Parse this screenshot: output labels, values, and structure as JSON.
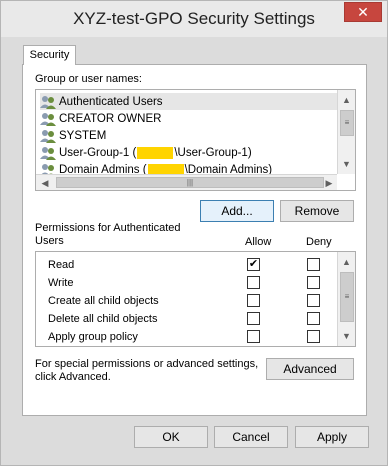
{
  "window": {
    "title": "XYZ-test-GPO Security Settings",
    "close_glyph": "✕"
  },
  "tabs": [
    {
      "label": "Security"
    }
  ],
  "group_label": "Group or user names:",
  "users": [
    {
      "name": "Authenticated Users",
      "icon": "users-group-icon",
      "selected": true
    },
    {
      "name": "CREATOR OWNER",
      "icon": "users-group-icon"
    },
    {
      "name": "SYSTEM",
      "icon": "users-group-icon"
    },
    {
      "prefix": "User-Group-1 (",
      "suffix": "\\User-Group-1)",
      "redacted": true,
      "icon": "users-group-icon"
    },
    {
      "prefix": "Domain Admins (",
      "suffix": "\\Domain Admins)",
      "redacted": true,
      "icon": "users-group-icon"
    }
  ],
  "user_buttons": {
    "add": "Add...",
    "remove": "Remove"
  },
  "permissions": {
    "header": "Permissions for Authenticated Users",
    "allow_label": "Allow",
    "deny_label": "Deny",
    "rows": [
      {
        "name": "Read",
        "allow": true,
        "deny": false
      },
      {
        "name": "Write",
        "allow": false,
        "deny": false
      },
      {
        "name": "Create all child objects",
        "allow": false,
        "deny": false
      },
      {
        "name": "Delete all child objects",
        "allow": false,
        "deny": false
      },
      {
        "name": "Apply group policy",
        "allow": false,
        "deny": false
      }
    ]
  },
  "advanced": {
    "text": "For special permissions or advanced settings, click Advanced.",
    "button": "Advanced"
  },
  "dialog_buttons": {
    "ok": "OK",
    "cancel": "Cancel",
    "apply": "Apply"
  },
  "scroll_glyphs": {
    "up": "▲",
    "down": "▼",
    "left": "◀",
    "right": "▶",
    "grip": "≡",
    "hgrip": "|||"
  },
  "check_glyph": "✔",
  "colors": {
    "redaction": "#ffd400",
    "close": "#c7463e"
  }
}
